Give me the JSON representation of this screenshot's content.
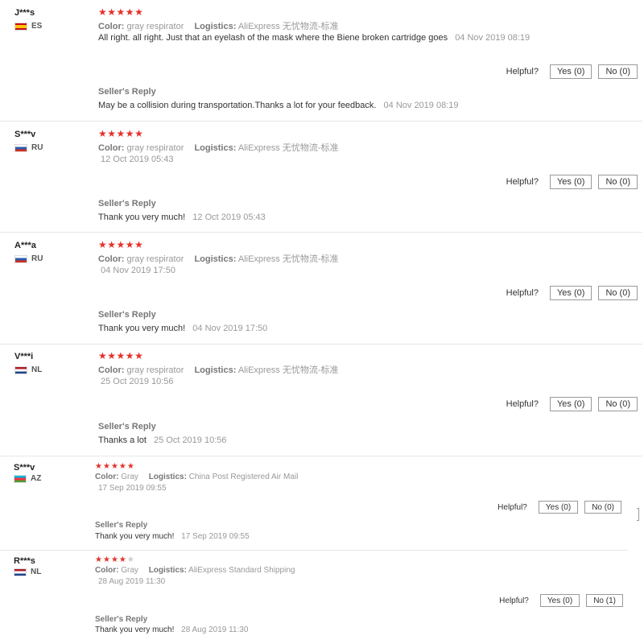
{
  "helpful_label": "Helpful?",
  "seller_reply_label": "Seller's Reply",
  "meta_labels": {
    "color": "Color:",
    "logistics": "Logistics:"
  },
  "reviews": [
    {
      "user": "J***s",
      "country": "ES",
      "stars": 5,
      "color": "gray respirator",
      "logistics": "AliExpress 无忧物流-标准",
      "text": "All right. all right. Just that an eyelash of the mask where the Biene broken cartridge goes",
      "date": "04 Nov 2019 08:19",
      "yes": "Yes (0)",
      "no": "No (0)",
      "reply": "May be a collision during transportation.Thanks a lot for your feedback.",
      "reply_date": "04 Nov 2019 08:19"
    },
    {
      "user": "S***v",
      "country": "RU",
      "stars": 5,
      "color": "gray respirator",
      "logistics": "AliExpress 无忧物流-标准",
      "date": "12 Oct 2019 05:43",
      "yes": "Yes (0)",
      "no": "No (0)",
      "reply": "Thank you very much!",
      "reply_date": "12 Oct 2019 05:43"
    },
    {
      "user": "A***a",
      "country": "RU",
      "stars": 5,
      "color": "gray respirator",
      "logistics": "AliExpress 无忧物流-标准",
      "date": "04 Nov 2019 17:50",
      "yes": "Yes (0)",
      "no": "No (0)",
      "reply": "Thank you very much!",
      "reply_date": "04 Nov 2019 17:50"
    },
    {
      "user": "V***i",
      "country": "NL",
      "stars": 5,
      "color": "gray respirator",
      "logistics": "AliExpress 无忧物流-标准",
      "date": "25 Oct 2019 10:56",
      "yes": "Yes (0)",
      "no": "No (0)",
      "reply": "Thanks a lot",
      "reply_date": "25 Oct 2019 10:56"
    },
    {
      "user": "S***v",
      "country": "AZ",
      "stars": 5,
      "color": "Gray",
      "logistics": "China Post Registered Air Mail",
      "date": "17 Sep 2019 09:55",
      "yes": "Yes (0)",
      "no": "No (0)",
      "reply": "Thank you very much!",
      "reply_date": "17 Sep 2019 09:55"
    },
    {
      "user": "R***s",
      "country": "NL",
      "stars": 4,
      "color": "Gray",
      "logistics": "AliExpress Standard Shipping",
      "date": "28 Aug 2019 11:30",
      "yes": "Yes (0)",
      "no": "No (1)",
      "reply": "Thank you very much!",
      "reply_date": "28 Aug 2019 11:30"
    }
  ]
}
